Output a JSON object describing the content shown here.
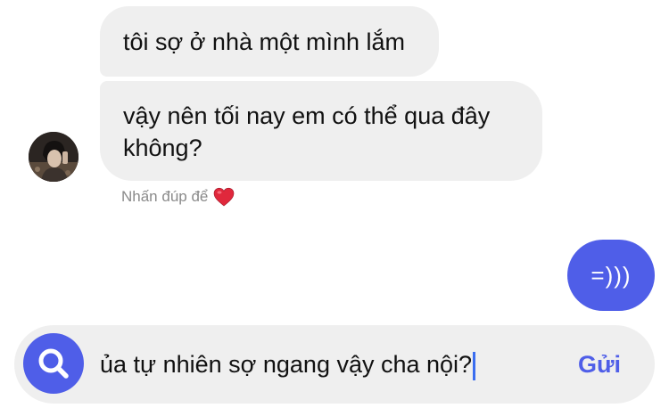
{
  "messages": {
    "received": [
      "tôi sợ ở nhà một mình lắm",
      "vậy nên tối nay em có thể qua đây không?"
    ],
    "hint": "Nhấn đúp để",
    "sent": "=)))"
  },
  "composer": {
    "input_value": "ủa tự nhiên sợ ngang vậy cha nội?",
    "send_label": "Gửi"
  },
  "colors": {
    "accent": "#4f5ee8",
    "incoming_bubble": "#efefef",
    "heart": "#e0283c"
  }
}
